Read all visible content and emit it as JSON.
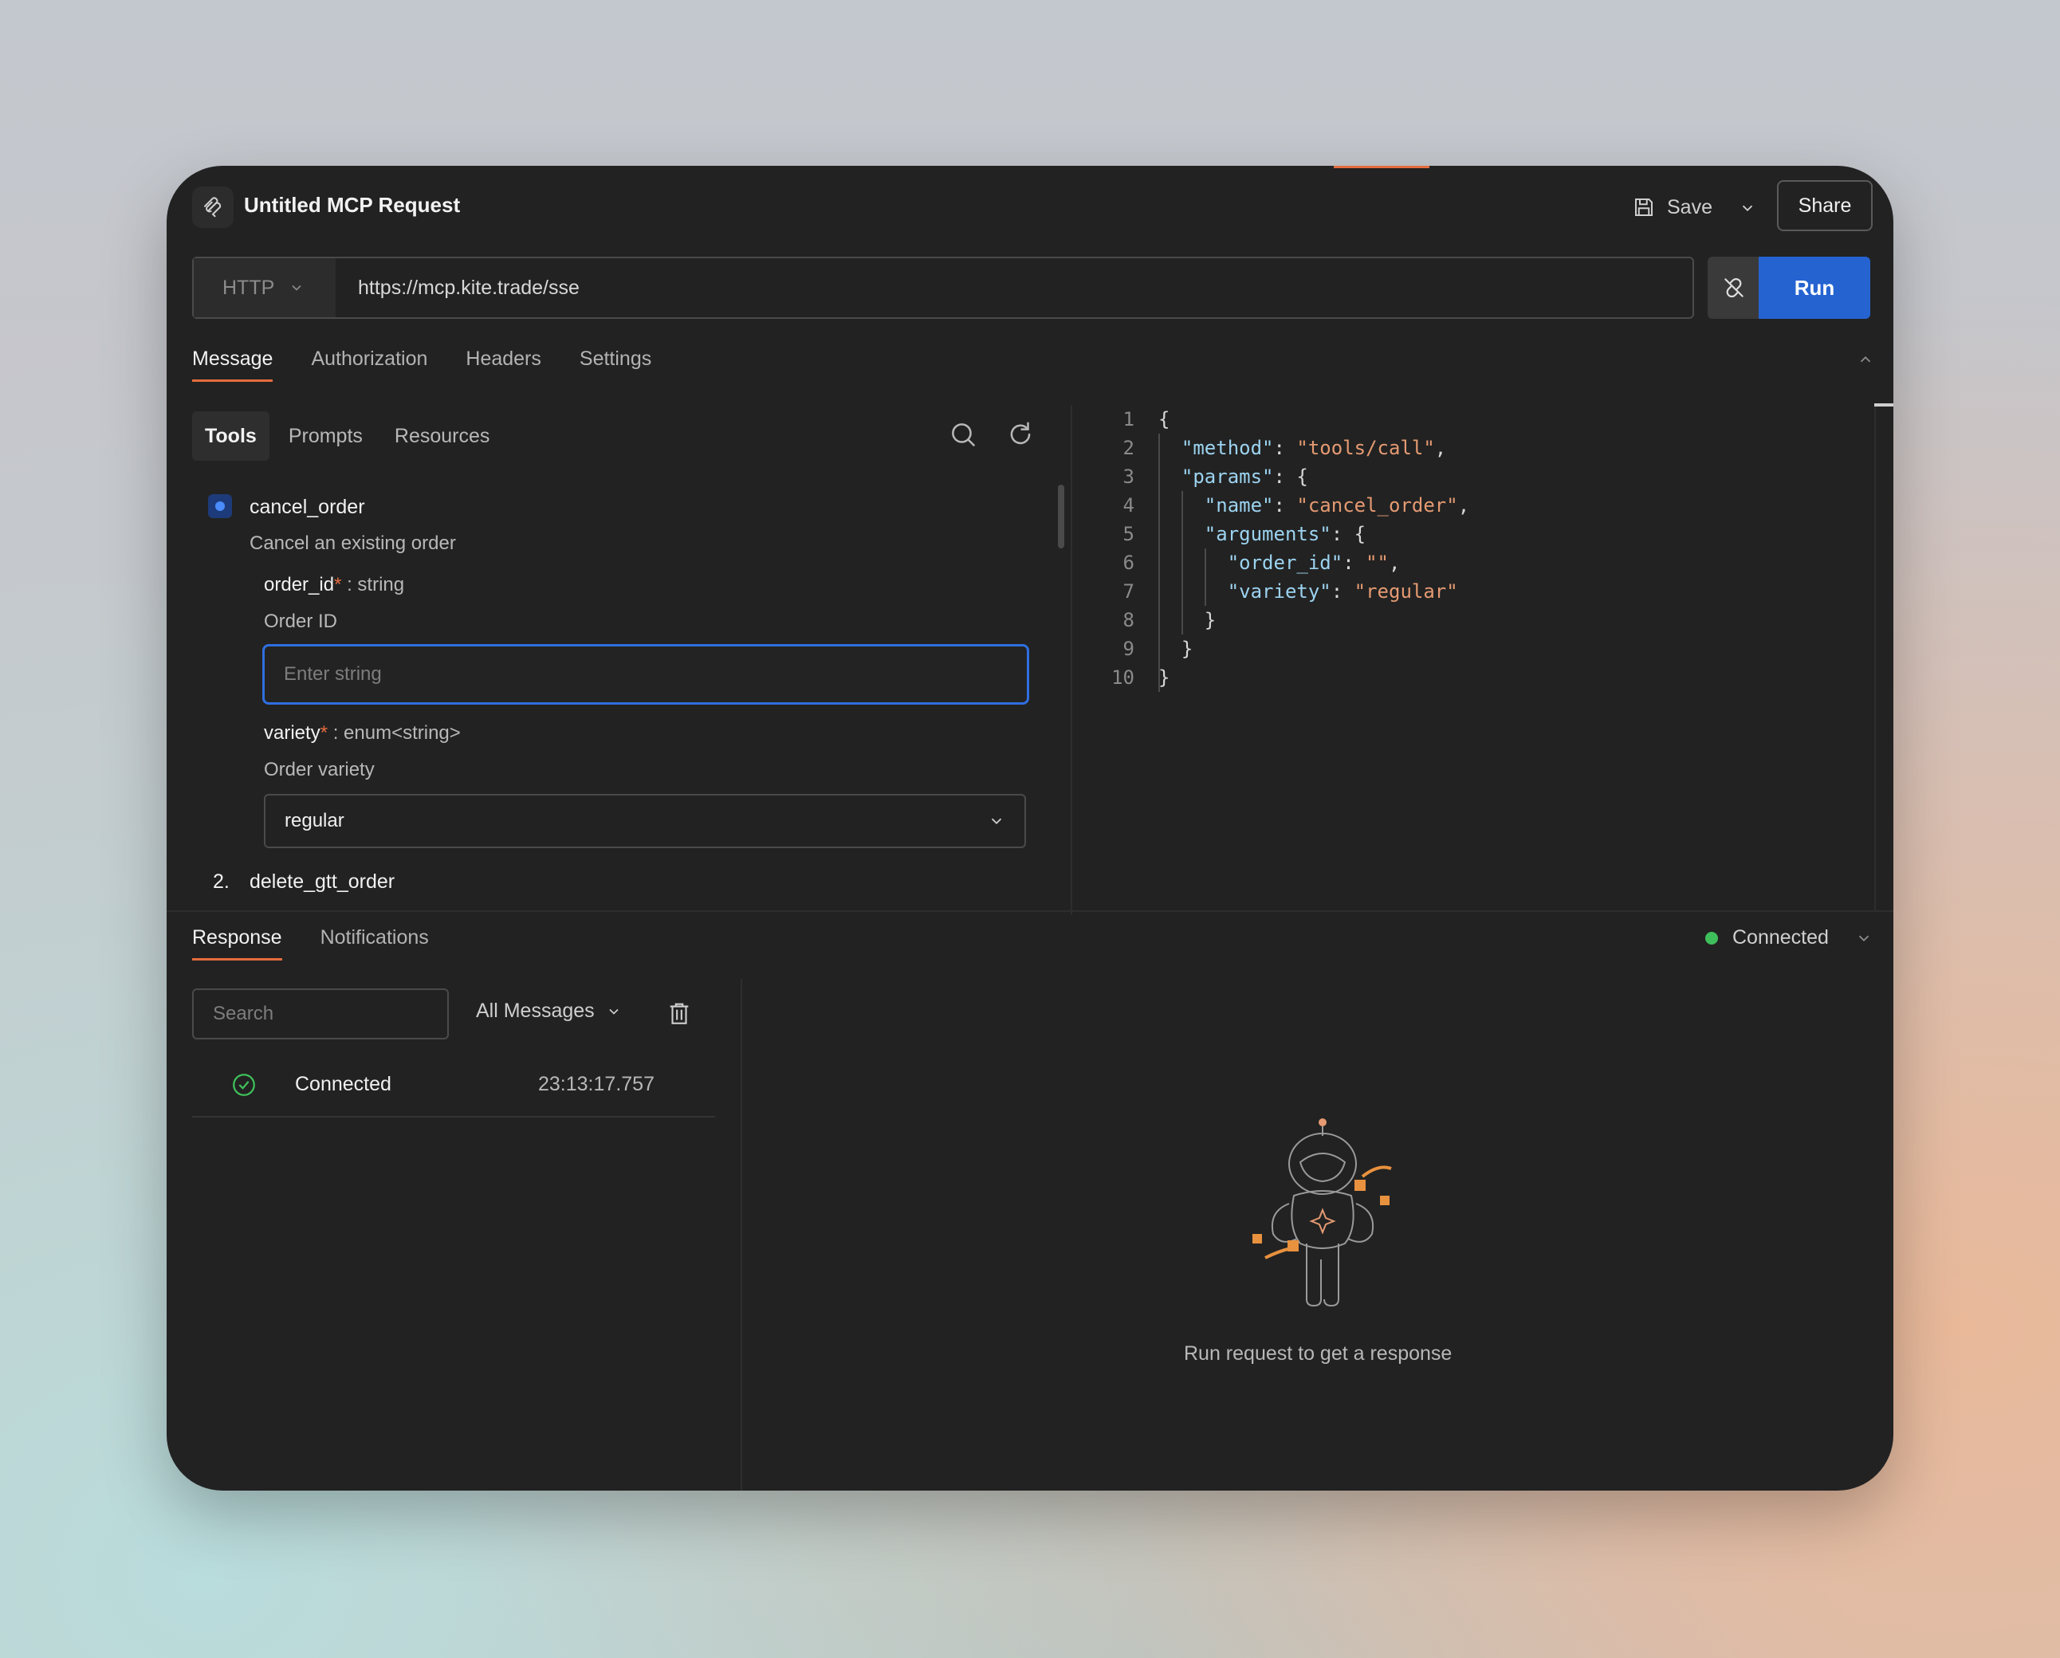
{
  "header": {
    "title": "Untitled MCP Request",
    "save_label": "Save",
    "share_label": "Share"
  },
  "request": {
    "method": "HTTP",
    "url": "https://mcp.kite.trade/sse",
    "run_label": "Run"
  },
  "tabs": [
    {
      "label": "Message",
      "active": true
    },
    {
      "label": "Authorization"
    },
    {
      "label": "Headers"
    },
    {
      "label": "Settings"
    }
  ],
  "subtabs": [
    {
      "label": "Tools",
      "active": true
    },
    {
      "label": "Prompts"
    },
    {
      "label": "Resources"
    }
  ],
  "tools": {
    "selected": {
      "name": "cancel_order",
      "description": "Cancel an existing order",
      "params": [
        {
          "name": "order_id",
          "required": "*",
          "type": ": string",
          "description": "Order ID",
          "placeholder": "Enter string"
        },
        {
          "name": "variety",
          "required": "*",
          "type": ": enum<string>",
          "description": "Order variety",
          "value": "regular"
        }
      ]
    },
    "next": {
      "number": "2.",
      "name": "delete_gtt_order"
    }
  },
  "code": [
    {
      "n": "1"
    },
    {
      "n": "2"
    },
    {
      "n": "3"
    },
    {
      "n": "4"
    },
    {
      "n": "5"
    },
    {
      "n": "6"
    },
    {
      "n": "7"
    },
    {
      "n": "8"
    },
    {
      "n": "9"
    },
    {
      "n": "10"
    }
  ],
  "code_text": {
    "method_key": "\"method\"",
    "method_val": "\"tools/call\"",
    "params_key": "\"params\"",
    "name_key": "\"name\"",
    "name_val": "\"cancel_order\"",
    "arguments_key": "\"arguments\"",
    "order_id_key": "\"order_id\"",
    "order_id_val": "\"\"",
    "variety_key": "\"variety\"",
    "variety_val": "\"regular\""
  },
  "response": {
    "tabs": [
      {
        "label": "Response",
        "active": true
      },
      {
        "label": "Notifications"
      }
    ],
    "status": "Connected",
    "search_placeholder": "Search",
    "filter": "All Messages",
    "messages": [
      {
        "text": "Connected",
        "time": "23:13:17.757"
      }
    ],
    "empty_text": "Run request to get a response"
  },
  "colors": {
    "accent": "#e46c3f",
    "primary": "#2563d1",
    "connected": "#3fbf5b"
  }
}
